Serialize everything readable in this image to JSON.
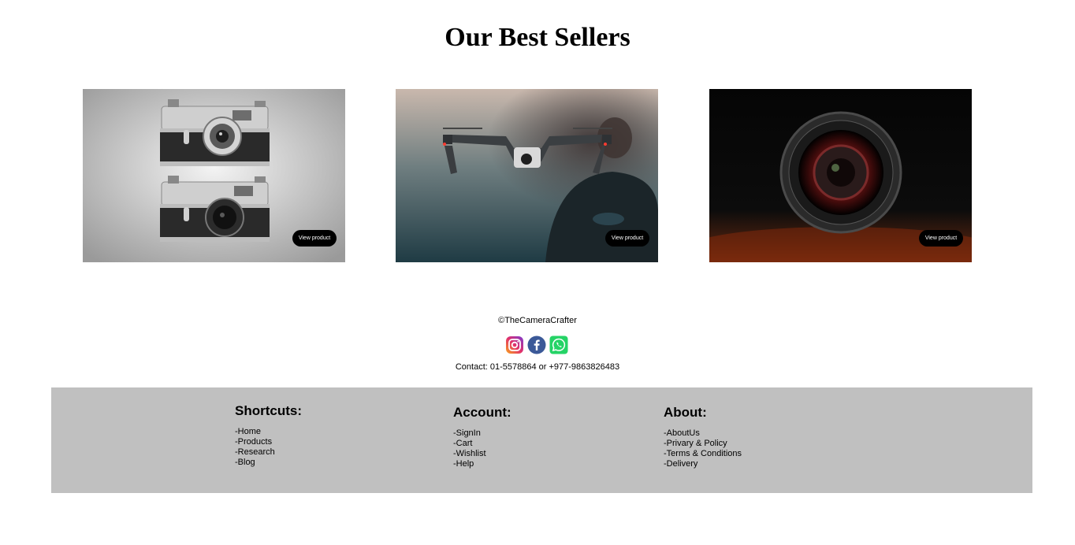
{
  "page": {
    "heading": "Our Best Sellers"
  },
  "products": [
    {
      "image": "twin-rangefinder-cameras-photo",
      "button_label": "View product"
    },
    {
      "image": "drone-in-flight-photo",
      "button_label": "View product"
    },
    {
      "image": "camera-lens-photo",
      "button_label": "View product"
    }
  ],
  "footer_top": {
    "copyright": "©TheCameraCrafter",
    "socials": [
      "instagram-icon",
      "facebook-icon",
      "whatsapp-icon"
    ],
    "contact": "Contact: 01-5578864 or +977-9863826483"
  },
  "footer": {
    "columns": [
      {
        "title": "Shortcuts:",
        "links": [
          "-Home",
          "-Products",
          "-Research",
          "-Blog"
        ]
      },
      {
        "title": "Account:",
        "links": [
          "-SignIn",
          "-Cart",
          "-Wishlist",
          "-Help"
        ]
      },
      {
        "title": "About:",
        "links": [
          "-AboutUs",
          "-Privary & Policy",
          "-Terms & Conditions",
          "-Delivery"
        ]
      }
    ]
  },
  "colors": {
    "footer_bg": "#c0c0c0",
    "button_bg": "#000000",
    "button_text": "#ffffff"
  }
}
